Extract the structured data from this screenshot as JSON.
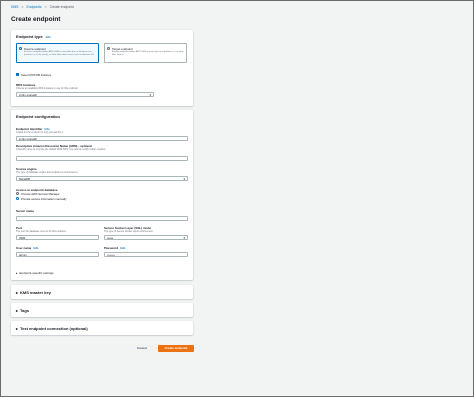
{
  "breadcrumb": {
    "items": [
      "DMS",
      "Endpoints",
      "Create endpoint"
    ],
    "separator": ">"
  },
  "page_title": "Create endpoint",
  "endpoint_type": {
    "header": "Endpoint type",
    "info": "Info",
    "source": {
      "title": "Source endpoint",
      "desc": "A source endpoint allows AWS DMS to read data from a database (on premises or in the cloud), or from other data source such as Amazon S3.",
      "selected": true
    },
    "target": {
      "title": "Target endpoint",
      "desc": "A target endpoint allows AWS DMS to write data to a database, or to other data source.",
      "selected": false
    },
    "rds_checkbox_label": "Select RDS DB instance",
    "rds_label": "RDS Instance",
    "rds_hint": "Choose an available RDS instance to use for this endpoint.",
    "rds_value": "imdm-mariadb"
  },
  "endpoint_config": {
    "header": "Endpoint configuration",
    "identifier_label": "Endpoint identifier",
    "identifier_info": "Info",
    "identifier_hint": "A label for the endpoint to help you identify it.",
    "identifier_value": "imdm-mariadb",
    "arn_label": "Descriptive Amazon Resource Name (ARN) - optional",
    "arn_hint": "A friendly name to override the default DMS ARN. You cannot modify it after creation.",
    "arn_value": "",
    "engine_label": "Source engine",
    "engine_hint": "The type of database engine this endpoint is connected to.",
    "engine_value": "MariaDB",
    "access_label": "Access to endpoint database",
    "access_opt1": "Choose AWS Secrets Manager",
    "access_opt2": "Provide access information manually",
    "server_label": "Server name",
    "server_value": "",
    "port_label": "Port",
    "port_hint": "The port the database runs on for this endpoint.",
    "port_value": "3306",
    "ssl_label": "Secure Socket Layer (SSL) mode",
    "ssl_hint": "The type of Secure Socket Layer enforcement",
    "ssl_value": "none",
    "user_label": "User name",
    "user_info": "Info",
    "user_value": "admin",
    "password_label": "Password",
    "password_info": "Info",
    "password_value": "••••••••",
    "specific_settings": "Endpoint-specific settings"
  },
  "sections": {
    "kms": "KMS master key",
    "tags": "Tags",
    "test": "Test endpoint connection (optional)"
  },
  "actions": {
    "cancel": "Cancel",
    "create": "Create endpoint"
  },
  "colors": {
    "accent": "#0073bb",
    "primary_button": "#ec7211",
    "background": "#f2f3f3"
  }
}
